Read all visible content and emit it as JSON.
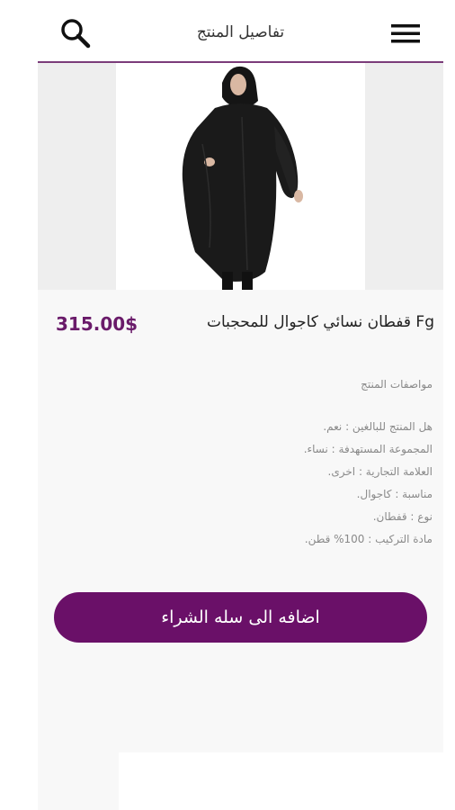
{
  "header": {
    "title": "تفاصيل المنتج",
    "search_icon": "search-icon",
    "menu_icon": "hamburger-menu-icon",
    "accent_color": "#7b3c7a"
  },
  "product": {
    "name": "Fg قفطان نسائي كاجوال للمحجبات",
    "price": "315.00$",
    "image_alt": "black-abaya-photo"
  },
  "specifications": {
    "header": "مواصفات المنتج",
    "items": [
      "هل المنتج للبالغين : نعم.",
      "المجموعة المستهدفة : نساء.",
      "العلامة التجارية : اخرى.",
      "مناسبة : كاجوال.",
      "نوع : قفطان.",
      "مادة التركيب : 100% قطن."
    ]
  },
  "cart": {
    "label": "اضافه الى سله الشراء",
    "color": "#6a1068"
  }
}
